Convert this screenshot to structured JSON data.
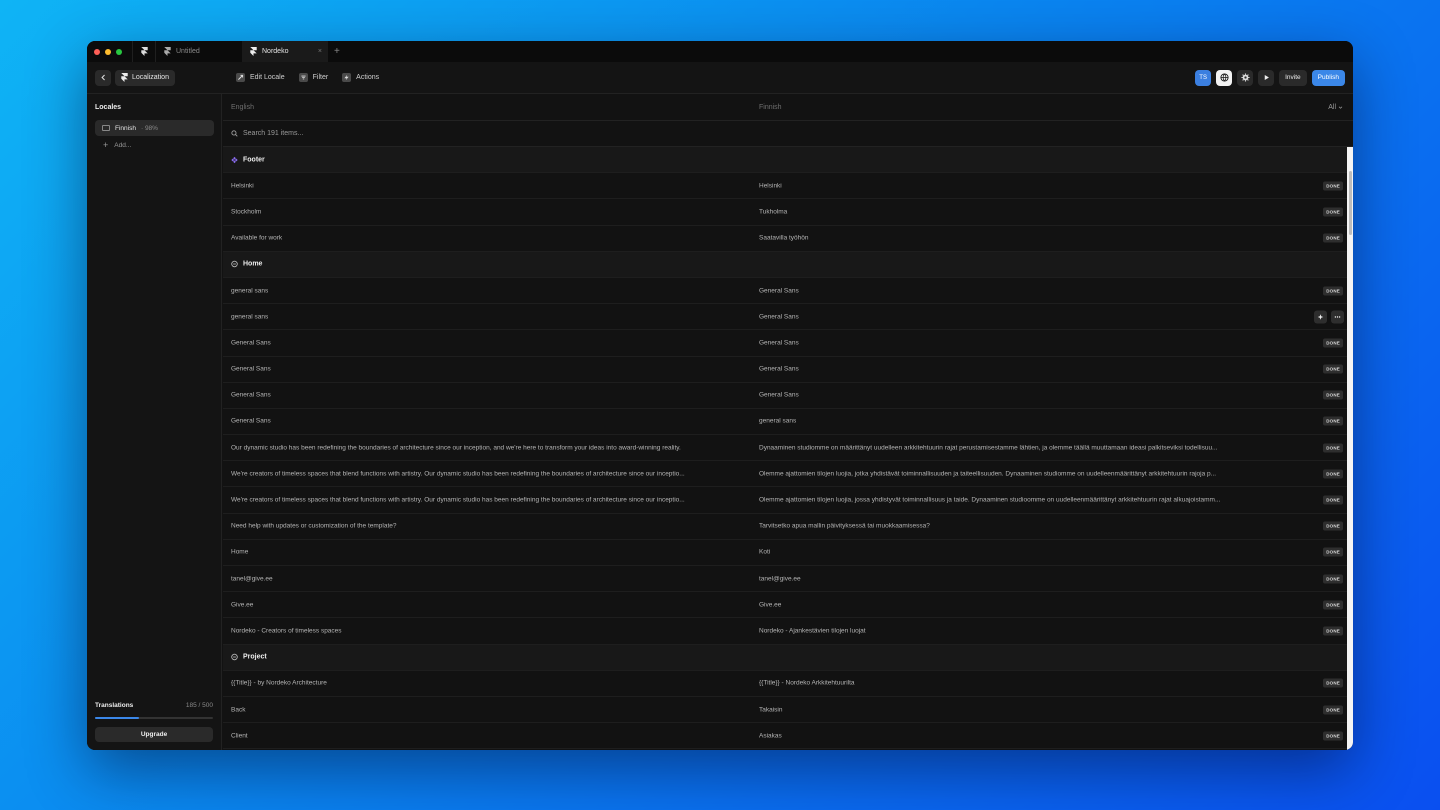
{
  "tabs": {
    "untitled": "Untitled",
    "active": "Nordeko",
    "close": "×",
    "add": "+"
  },
  "toolbar": {
    "breadcrumb": "Localization",
    "edit_locale": "Edit Locale",
    "filter": "Filter",
    "actions": "Actions",
    "avatar": "TS",
    "invite": "Invite",
    "publish": "Publish"
  },
  "sidebar": {
    "title": "Locales",
    "locale_name": "Finnish",
    "locale_pct": "· 98%",
    "add": "Add...",
    "translations_label": "Translations",
    "translations_count": "185 / 500",
    "translations_progress": 0.37,
    "upgrade": "Upgrade"
  },
  "columns": {
    "source": "English",
    "target": "Finnish",
    "filter": "All"
  },
  "search": {
    "placeholder": "Search 191 items..."
  },
  "status_label": "DONE",
  "rows": [
    {
      "type": "group",
      "name": "Footer",
      "icon": "component-icon"
    },
    {
      "en": "Helsinki",
      "fi": "Helsinki"
    },
    {
      "en": "Stockholm",
      "fi": "Tukholma"
    },
    {
      "en": "Available for work",
      "fi": "Saatavilla työhön"
    },
    {
      "type": "group",
      "name": "Home",
      "icon": "page-icon"
    },
    {
      "en": "general sans",
      "fi": "General Sans"
    },
    {
      "en": "general sans",
      "fi": "General Sans",
      "hover": true
    },
    {
      "en": "General Sans",
      "fi": "General Sans"
    },
    {
      "en": "General Sans",
      "fi": "General Sans"
    },
    {
      "en": "General Sans",
      "fi": "General Sans"
    },
    {
      "en": "General Sans",
      "fi": "general sans"
    },
    {
      "en": "Our dynamic studio has been redefining the boundaries of architecture since our inception, and we're here to transform your ideas into award-winning reality.",
      "fi": "Dynaaminen studiomme on määrittänyt uudelleen arkkitehtuurin rajat perustamisestamme lähtien, ja olemme täällä muuttamaan ideasi palkitseviksi todellisuu..."
    },
    {
      "en": "We're creators of timeless spaces that blend functions with artistry. Our dynamic studio has been redefining the boundaries of architecture since our inceptio...",
      "fi": "Olemme ajattomien tilojen luojia, jotka yhdistävät toiminnallisuuden ja taiteellisuuden. Dynaaminen studiomme on uudelleenmäärittänyt arkkitehtuurin rajoja p..."
    },
    {
      "en": "We're creators of timeless spaces that blend functions with artistry. Our dynamic studio has been redefining the boundaries of architecture since our inceptio...",
      "fi": "Olemme ajattomien tilojen luojia, jossa yhdistyvät toiminnallisuus ja taide. Dynaaminen studioomme on uudelleenmäärittänyt arkkitehtuurin rajat alkuajoistamm..."
    },
    {
      "en": "Need help with updates or customization of the template?",
      "fi": "Tarvitsetko apua mallin päivityksessä tai muokkaamisessa?"
    },
    {
      "en": "Home",
      "fi": "Koti"
    },
    {
      "en": "tanel@give.ee",
      "fi": "tanel@give.ee"
    },
    {
      "en": "Give.ee",
      "fi": "Give.ee"
    },
    {
      "en": "Nordeko - Creators of timeless spaces",
      "fi": "Nordeko - Ajankestävien tilojen luojat"
    },
    {
      "type": "group",
      "name": "Project",
      "icon": "page-icon"
    },
    {
      "en": "{{Title}} - by Nordeko Architecture",
      "fi": "{{Title}} - Nordeko Arkkitehtuurilta"
    },
    {
      "en": "Back",
      "fi": "Takaisin"
    },
    {
      "en": "Client",
      "fi": "Asiakas"
    }
  ],
  "colors": {
    "accent": "#3b87e8",
    "traffic_red": "#ff5f57",
    "traffic_yellow": "#febc2e",
    "traffic_green": "#28c840",
    "component_icon": "#8a6cf0"
  }
}
